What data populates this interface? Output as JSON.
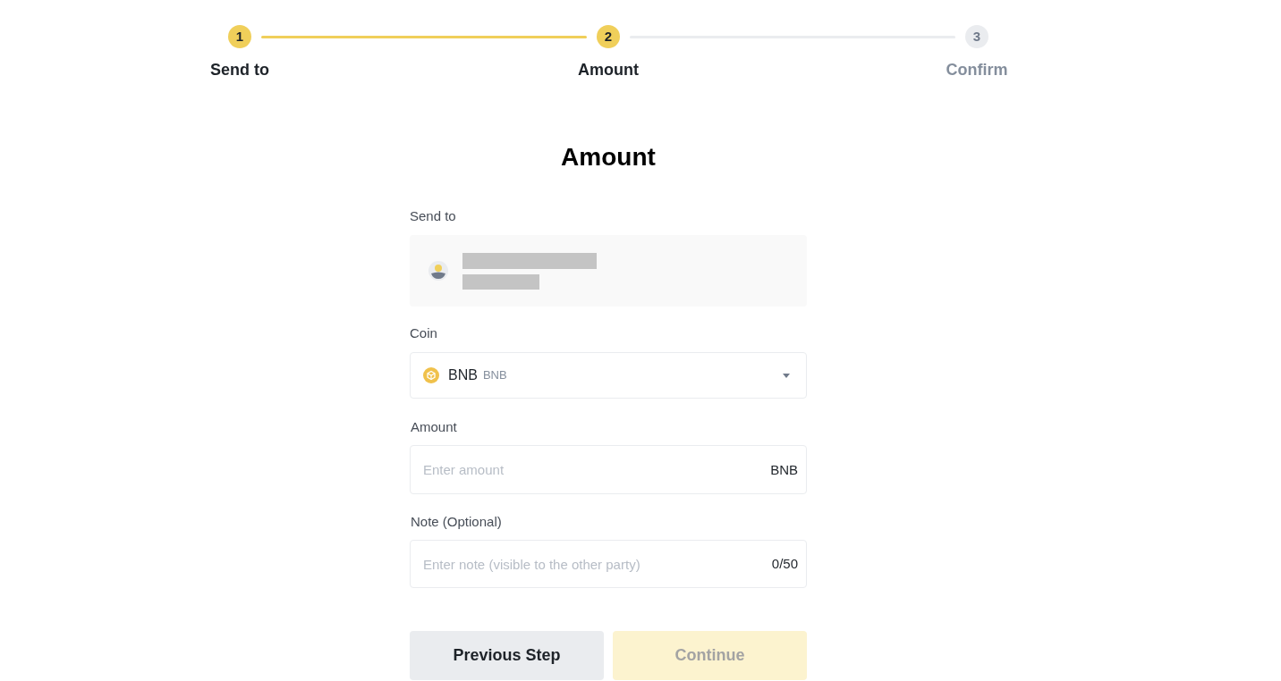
{
  "stepper": {
    "steps": [
      {
        "number": "1",
        "label": "Send to",
        "reached": true
      },
      {
        "number": "2",
        "label": "Amount",
        "reached": true
      },
      {
        "number": "3",
        "label": "Confirm",
        "reached": false
      }
    ]
  },
  "title": "Amount",
  "form": {
    "send_to": {
      "label": "Send to"
    },
    "coin": {
      "label": "Coin",
      "value": "BNB",
      "ticker": "BNB"
    },
    "amount": {
      "label": "Amount",
      "placeholder": "Enter amount",
      "suffix": "BNB"
    },
    "note": {
      "label": "Note (Optional)",
      "placeholder": "Enter note (visible to the other party)",
      "counter": "0/50"
    }
  },
  "buttons": [
    {
      "label": "Previous Step",
      "kind": "secondary",
      "disabled": false
    },
    {
      "label": "Continue",
      "kind": "primary",
      "disabled": true
    }
  ]
}
